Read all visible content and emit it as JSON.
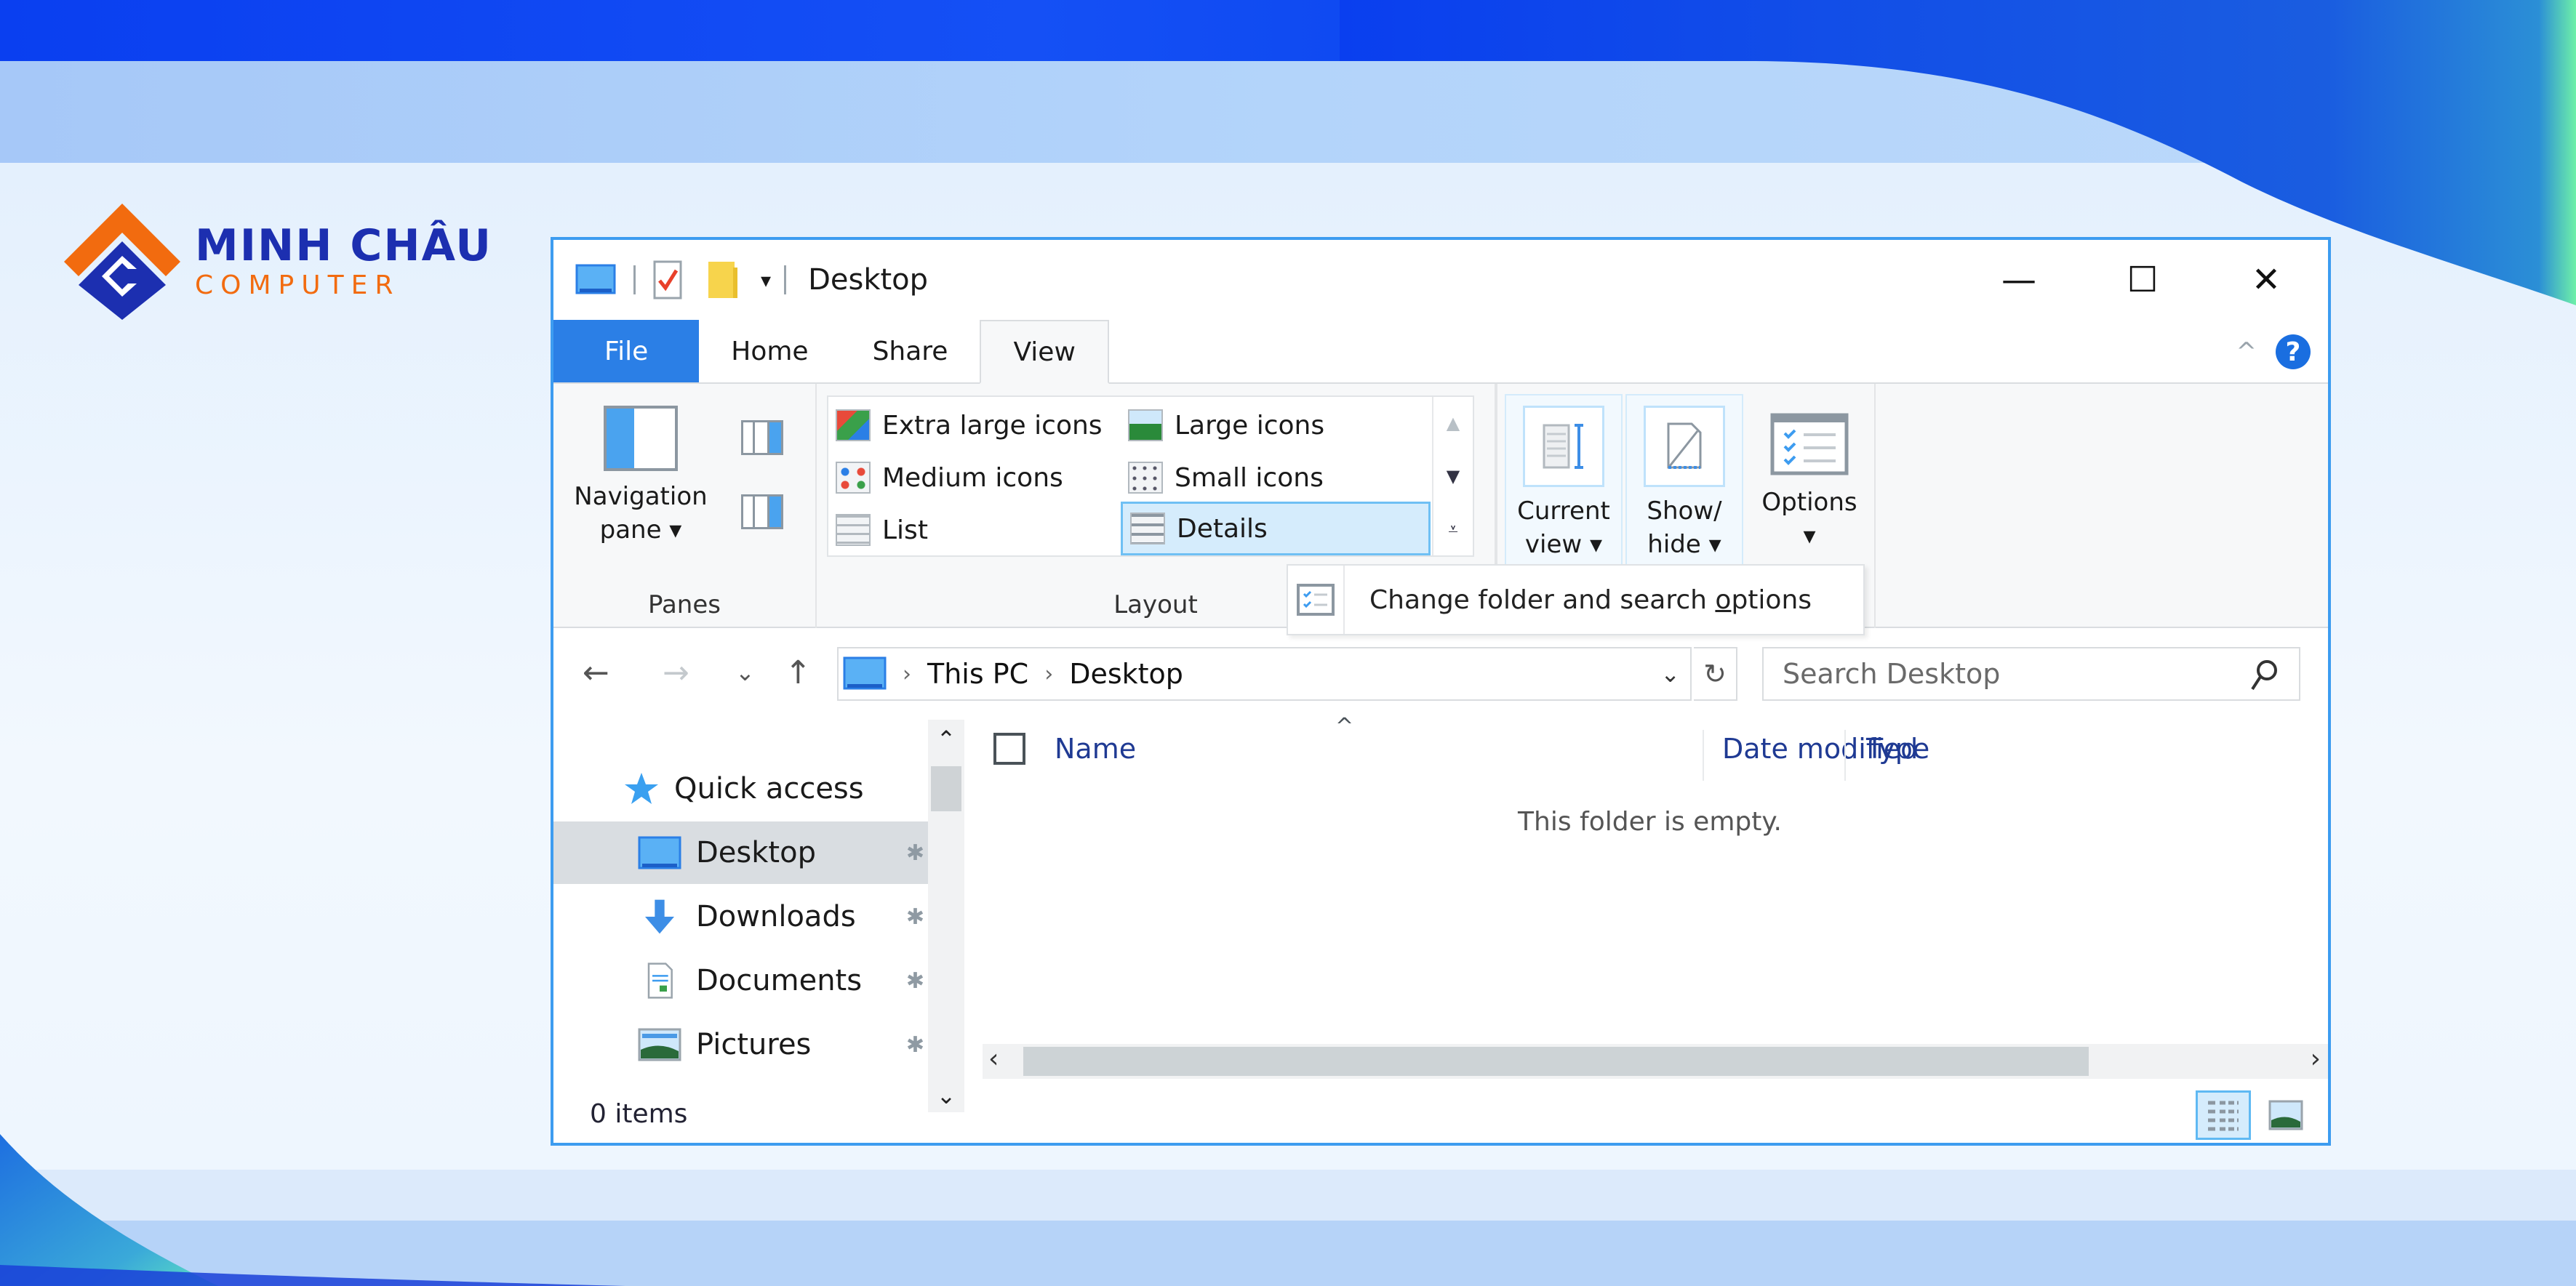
{
  "brand": {
    "line1": "MINH CHÂU",
    "line2": "COMPUTER",
    "colors": {
      "navy": "#1c2fb0",
      "orange": "#f26b0f"
    }
  },
  "window": {
    "title": "Desktop",
    "quick_access_toolbar": [
      "computer-icon",
      "properties-icon",
      "new-folder-icon",
      "customize-qat-icon"
    ],
    "controls": {
      "minimize": "—",
      "maximize": "☐",
      "close": "✕"
    },
    "accent_color": "#3d9cf0"
  },
  "ribbon": {
    "tabs": [
      {
        "label": "File",
        "type": "file"
      },
      {
        "label": "Home"
      },
      {
        "label": "Share"
      },
      {
        "label": "View",
        "active": true
      }
    ],
    "collapse_icon": "^",
    "help_icon": "?",
    "groups": {
      "panes": {
        "label": "Panes",
        "navigation_pane": {
          "line1": "Navigation",
          "line2": "pane ▾"
        }
      },
      "layout": {
        "label": "Layout",
        "items": [
          {
            "label": "Extra large icons"
          },
          {
            "label": "Large icons"
          },
          {
            "label": "Medium icons"
          },
          {
            "label": "Small icons"
          },
          {
            "label": "List"
          },
          {
            "label": "Details",
            "selected": true
          }
        ]
      },
      "current_view": {
        "line1": "Current",
        "line2": "view ▾"
      },
      "show_hide": {
        "line1": "Show/",
        "line2": "hide ▾"
      },
      "options": {
        "line1": "Options",
        "line2": "▾"
      }
    },
    "tooltip": {
      "before": "Change folder and search ",
      "underlined": "o",
      "after": "ptions"
    }
  },
  "address": {
    "back": "←",
    "forward": "→",
    "recent": "⌄",
    "up": "↑",
    "crumbs": [
      "This PC",
      "Desktop"
    ],
    "separator": "›",
    "dropdown": "⌄",
    "refresh": "↻",
    "search_placeholder": "Search Desktop"
  },
  "nav_pane": {
    "items": [
      {
        "label": "Quick access",
        "icon": "star-icon"
      },
      {
        "label": "Desktop",
        "icon": "desktop-icon",
        "pinned": true,
        "selected": true
      },
      {
        "label": "Downloads",
        "icon": "download-icon",
        "pinned": true
      },
      {
        "label": "Documents",
        "icon": "documents-icon",
        "pinned": true
      },
      {
        "label": "Pictures",
        "icon": "pictures-icon",
        "pinned": true
      }
    ],
    "pin_glyph": "📌"
  },
  "file_list": {
    "columns": [
      "Name",
      "Date modified",
      "Type"
    ],
    "sort_indicator": "^",
    "empty_message": "This folder is empty."
  },
  "status": {
    "item_count": "0 items"
  }
}
